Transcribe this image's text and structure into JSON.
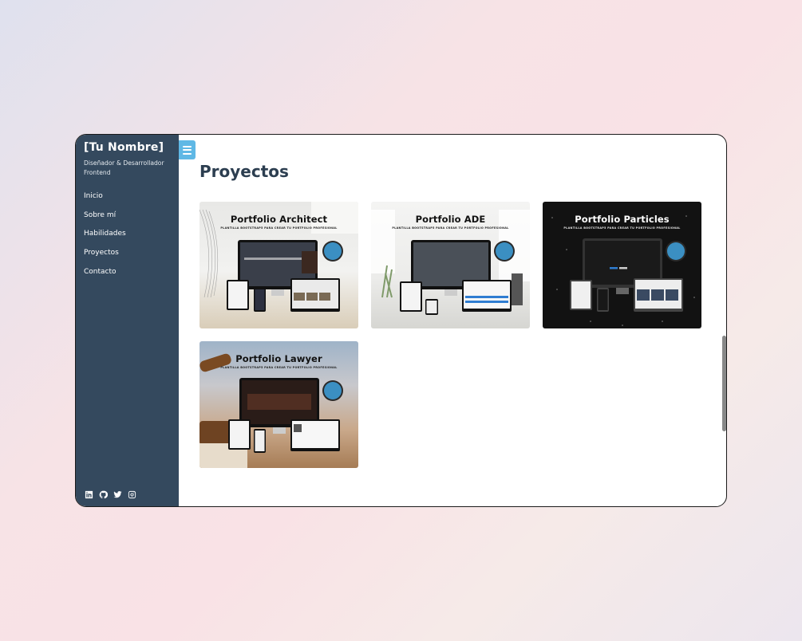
{
  "sidebar": {
    "brand": "[Tu Nombre]",
    "subtitle": "Diseñador & Desarrollador Frontend",
    "nav": [
      {
        "label": "Inicio"
      },
      {
        "label": "Sobre mí"
      },
      {
        "label": "Habilidades"
      },
      {
        "label": "Proyectos"
      },
      {
        "label": "Contacto"
      }
    ],
    "social_icons": [
      "linkedin-icon",
      "github-icon",
      "twitter-icon",
      "instagram-icon"
    ]
  },
  "main": {
    "title": "Proyectos",
    "projects": [
      {
        "title": "Portfolio Architect",
        "subtitle": "PLANTILLA BOOTSTRAP5 PARA CREAR TU PORTFOLIO PROFESIONAL",
        "theme": "light"
      },
      {
        "title": "Portfolio ADE",
        "subtitle": "PLANTILLA BOOTSTRAP5 PARA CREAR TU PORTFOLIO PROFESIONAL",
        "theme": "light"
      },
      {
        "title": "Portfolio Particles",
        "subtitle": "PLANTILLA BOOTSTRAP5 PARA CREAR TU PORTFOLIO PROFESIONAL",
        "theme": "dark"
      },
      {
        "title": "Portfolio Lawyer",
        "subtitle": "PLANTILLA BOOTSTRAP5 PARA CREAR TU PORTFOLIO PROFESIONAL",
        "theme": "warm"
      }
    ]
  },
  "colors": {
    "sidebar_bg": "#34495e",
    "accent": "#5fb8e5",
    "title": "#2c3e50"
  }
}
